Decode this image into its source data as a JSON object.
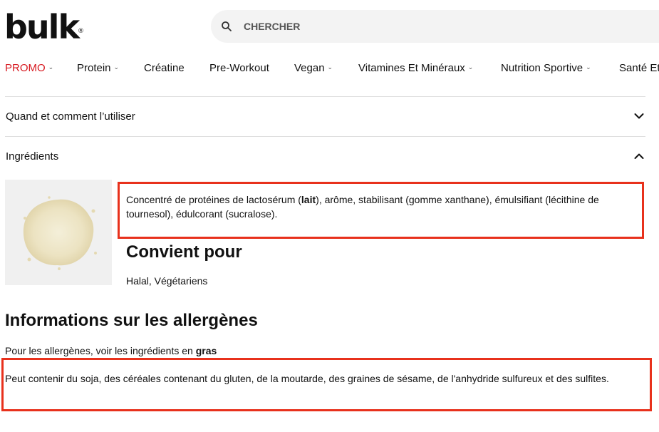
{
  "header": {
    "logo_text": "bulk",
    "logo_mark": "®",
    "search_placeholder": "CHERCHER"
  },
  "nav": {
    "items": [
      {
        "label": "PROMO",
        "has_dropdown": true,
        "color": "#d71920"
      },
      {
        "label": "Protein",
        "has_dropdown": true
      },
      {
        "label": "Créatine",
        "has_dropdown": false
      },
      {
        "label": "Pre-Workout",
        "has_dropdown": false
      },
      {
        "label": "Vegan",
        "has_dropdown": true
      },
      {
        "label": "Vitamines Et Minéraux",
        "has_dropdown": true
      },
      {
        "label": "Nutrition Sportive",
        "has_dropdown": true
      },
      {
        "label": "Santé Et",
        "has_dropdown": false
      }
    ]
  },
  "accordion": {
    "usage_label": "Quand et comment l’utiliser",
    "usage_state": "collapsed",
    "ingredients_label": "Ingrédients",
    "ingredients_state": "expanded"
  },
  "ingredients": {
    "text_before": "Concentré de protéines de lactosérum (",
    "allergen": "lait",
    "text_after": "), arôme, stabilisant (gomme xanthane), émulsifiant (lécithine de tournesol), édulcorant (sucralose).",
    "suitable_heading": "Convient pour",
    "suitable_text": "Halal, Végétariens"
  },
  "allergens": {
    "heading": "Informations sur les allergènes",
    "note_prefix": "Pour les allergènes, voir les ingrédients en ",
    "note_bold": "gras",
    "may_contain": "Peut contenir du soja, des céréales contenant du gluten, de la moutarde, des graines de sésame, de l'anhydride sulfureux et des sulfites."
  },
  "colors": {
    "accent_red": "#d71920",
    "highlight_border": "#e8311c",
    "search_bg": "#f3f3f3"
  }
}
